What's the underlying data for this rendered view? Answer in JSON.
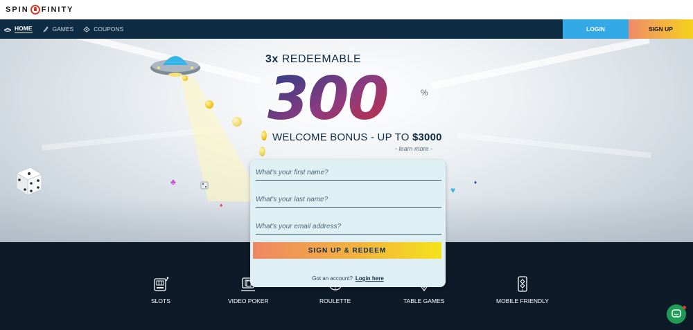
{
  "brand": {
    "logo_left": "SPIN",
    "logo_right": "FINITY",
    "accent": "#d9382b"
  },
  "nav": {
    "items": [
      {
        "label": "HOME",
        "icon": "ufo-icon",
        "active": true
      },
      {
        "label": "GAMES",
        "icon": "rocket-icon",
        "active": false
      },
      {
        "label": "COUPONS",
        "icon": "ticket-icon",
        "active": false
      }
    ],
    "login_label": "LOGIN",
    "signup_label": "SIGN UP",
    "background": "#0e2c44",
    "login_color": "#33a9e6"
  },
  "promo": {
    "prefix_bold": "3x",
    "prefix_rest": " REDEEMABLE",
    "amount": "300",
    "percent": "%",
    "line2_text": "WELCOME BONUS - UP TO ",
    "line2_amount": "$3000",
    "learn_more": "- learn more -"
  },
  "form": {
    "first_name_placeholder": "What's your first name?",
    "last_name_placeholder": "What's your last name?",
    "email_placeholder": "What's your email address?",
    "submit_label": "SIGN UP & REDEEM",
    "account_question": "Got an account?",
    "login_link": "Login here"
  },
  "features": [
    {
      "label": "SLOTS",
      "icon": "slot-machine-icon"
    },
    {
      "label": "VIDEO POKER",
      "icon": "video-poker-icon"
    },
    {
      "label": "ROULETTE",
      "icon": "roulette-icon"
    },
    {
      "label": "TABLE GAMES",
      "icon": "table-games-icon"
    },
    {
      "label": "MOBILE FRIENDLY",
      "icon": "mobile-icon"
    }
  ],
  "chat": {
    "icon": "chat-icon",
    "color": "#1e9b55"
  }
}
